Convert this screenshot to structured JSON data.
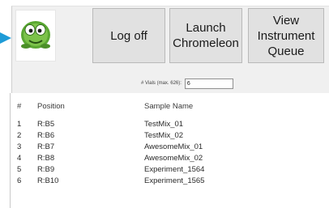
{
  "toolbar": {
    "logoff_label": "Log off",
    "launch_label": "Launch\nChromeleon",
    "view_label": "View\nInstrument\nQueue"
  },
  "vials": {
    "label": "# Vials (max. 626):",
    "value": "6"
  },
  "table": {
    "headers": {
      "num": "#",
      "position": "Position",
      "name": "Sample Name"
    },
    "rows": [
      {
        "num": "1",
        "position": "R:B5",
        "name": "TestMix_01"
      },
      {
        "num": "2",
        "position": "R:B6",
        "name": "TestMix_02"
      },
      {
        "num": "3",
        "position": "R:B7",
        "name": "AwesomeMix_01"
      },
      {
        "num": "4",
        "position": "R:B8",
        "name": "AwesomeMix_02"
      },
      {
        "num": "5",
        "position": "R:B9",
        "name": "Experiment_1564"
      },
      {
        "num": "6",
        "position": "R:B10",
        "name": "Experiment_1565"
      }
    ]
  },
  "colors": {
    "accent": "#1e9bd7",
    "button": "#e1e1e1",
    "panel": "#f0f0f0"
  },
  "icons": {
    "logo": "green-robot-mascot-icon",
    "tab": "arrow-tab-icon"
  }
}
